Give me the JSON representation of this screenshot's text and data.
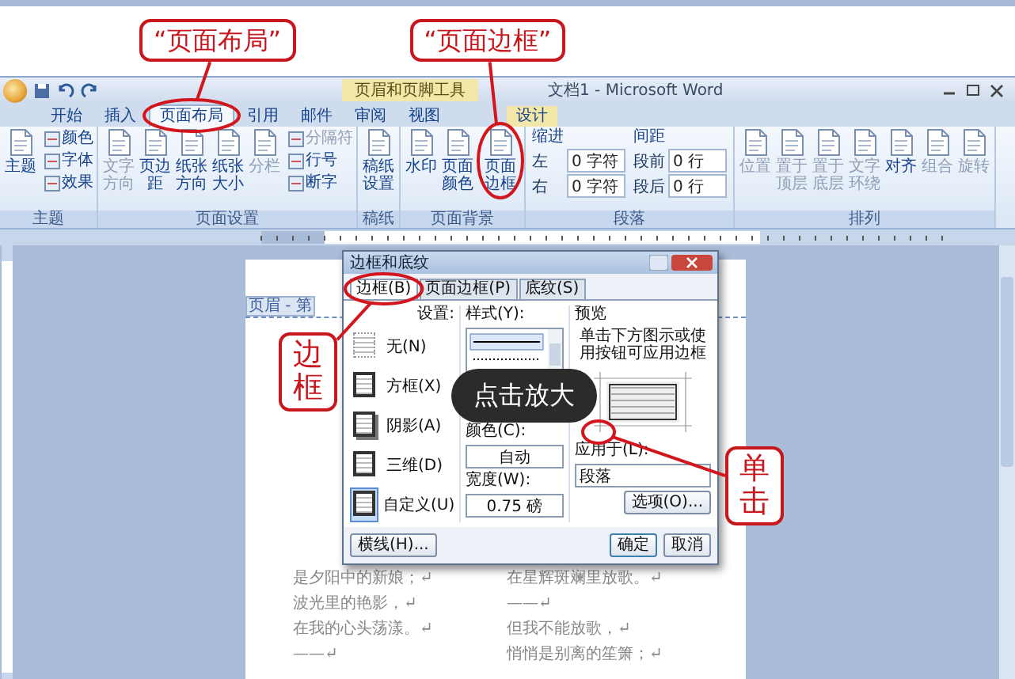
{
  "callouts": {
    "top": [
      "“页面布局”",
      "“页面边框”"
    ],
    "side": [
      "边框",
      "单击"
    ],
    "zoom_badge": "点击放大"
  },
  "window": {
    "context_group": "页眉和页脚工具",
    "title": "文档1 - Microsoft Word"
  },
  "tabs": [
    {
      "label": "开始",
      "selected": false,
      "circled": false
    },
    {
      "label": "插入",
      "selected": false,
      "circled": false
    },
    {
      "label": "页面布局",
      "selected": true,
      "circled": true
    },
    {
      "label": "引用",
      "selected": false,
      "circled": false
    },
    {
      "label": "邮件",
      "selected": false,
      "circled": false
    },
    {
      "label": "审阅",
      "selected": false,
      "circled": false
    },
    {
      "label": "视图",
      "selected": false,
      "circled": false
    },
    {
      "label": "设计",
      "selected": false,
      "circled": false
    }
  ],
  "ribbon": [
    {
      "name": "主题",
      "kind": "buttons",
      "items": [
        {
          "label": "主题",
          "kind": "large",
          "disabled": false,
          "circled": false
        },
        {
          "label": "颜色",
          "kind": "small",
          "disabled": false,
          "circled": false
        },
        {
          "label": "字体",
          "kind": "small",
          "disabled": false,
          "circled": false
        },
        {
          "label": "效果",
          "kind": "small",
          "disabled": false,
          "circled": false
        }
      ]
    },
    {
      "name": "页面设置",
      "kind": "buttons",
      "items": [
        {
          "label": "文字方向",
          "kind": "large",
          "disabled": true,
          "circled": false
        },
        {
          "label": "页边距",
          "kind": "large",
          "disabled": false,
          "circled": false
        },
        {
          "label": "纸张方向",
          "kind": "large",
          "disabled": false,
          "circled": false
        },
        {
          "label": "纸张大小",
          "kind": "large",
          "disabled": false,
          "circled": false
        },
        {
          "label": "分栏",
          "kind": "large",
          "disabled": true,
          "circled": false
        },
        {
          "label": "分隔符",
          "kind": "small",
          "disabled": true,
          "circled": false
        },
        {
          "label": "行号",
          "kind": "small",
          "disabled": false,
          "circled": false
        },
        {
          "label": "断字",
          "kind": "small",
          "disabled": false,
          "circled": false
        }
      ]
    },
    {
      "name": "稿纸",
      "kind": "buttons",
      "items": [
        {
          "label": "稿纸设置",
          "kind": "large",
          "disabled": false,
          "circled": false
        }
      ]
    },
    {
      "name": "页面背景",
      "kind": "buttons",
      "items": [
        {
          "label": "水印",
          "kind": "large",
          "disabled": false,
          "circled": false
        },
        {
          "label": "页面颜色",
          "kind": "large",
          "disabled": false,
          "circled": false
        },
        {
          "label": "页面边框",
          "kind": "large",
          "disabled": false,
          "circled": true
        }
      ]
    },
    {
      "name": "段落",
      "kind": "spinners",
      "columns": [
        {
          "heading": "缩进",
          "fields": [
            {
              "label": "左",
              "value": "0 字符"
            },
            {
              "label": "右",
              "value": "0 字符"
            }
          ]
        },
        {
          "heading": "间距",
          "fields": [
            {
              "label": "段前",
              "value": "0 行"
            },
            {
              "label": "段后",
              "value": "0 行"
            }
          ]
        }
      ]
    },
    {
      "name": "排列",
      "kind": "buttons",
      "items": [
        {
          "label": "位置",
          "kind": "large",
          "disabled": true,
          "circled": false
        },
        {
          "label": "置于顶层",
          "kind": "large",
          "disabled": true,
          "circled": false
        },
        {
          "label": "置于底层",
          "kind": "large",
          "disabled": true,
          "circled": false
        },
        {
          "label": "文字环绕",
          "kind": "large",
          "disabled": true,
          "circled": false
        },
        {
          "label": "对齐",
          "kind": "large",
          "disabled": false,
          "circled": false
        },
        {
          "label": "组合",
          "kind": "large",
          "disabled": true,
          "circled": false
        },
        {
          "label": "旋转",
          "kind": "large",
          "disabled": true,
          "circled": false
        }
      ]
    }
  ],
  "header_label": "页眉 - 第",
  "dialog": {
    "title": "边框和底纹",
    "tabs": [
      {
        "label": "边框(B)",
        "selected": true,
        "circled": true
      },
      {
        "label": "页面边框(P)",
        "selected": false,
        "circled": false
      },
      {
        "label": "底纹(S)",
        "selected": false,
        "circled": false
      }
    ],
    "setting_label": "设置:",
    "settings": [
      {
        "label": "无(N)",
        "selected": false
      },
      {
        "label": "方框(X)",
        "selected": false
      },
      {
        "label": "阴影(A)",
        "selected": false
      },
      {
        "label": "三维(D)",
        "selected": false
      },
      {
        "label": "自定义(U)",
        "selected": true
      }
    ],
    "style_label": "样式(Y):",
    "color_label": "颜色(C):",
    "color_value": "自动",
    "width_label": "宽度(W):",
    "width_value": "0.75 磅",
    "preview_label": "预览",
    "preview_hint": "单击下方图示或使用按钮可应用边框",
    "apply_label": "应用于(L):",
    "apply_value": "段落",
    "options_button": "选项(O)...",
    "line_button": "横线(H)...",
    "ok_button": "确定",
    "cancel_button": "取消"
  },
  "poem": [
    [
      "是夕阳中的新娘；↵",
      "在星辉斑斓里放歌。↵"
    ],
    [
      "波光里的艳影，↵",
      "——↵"
    ],
    [
      "在我的心头荡漾。↵",
      "但我不能放歌，↵"
    ],
    [
      "——↵",
      "悄悄是别离的笙箫；↵"
    ]
  ]
}
